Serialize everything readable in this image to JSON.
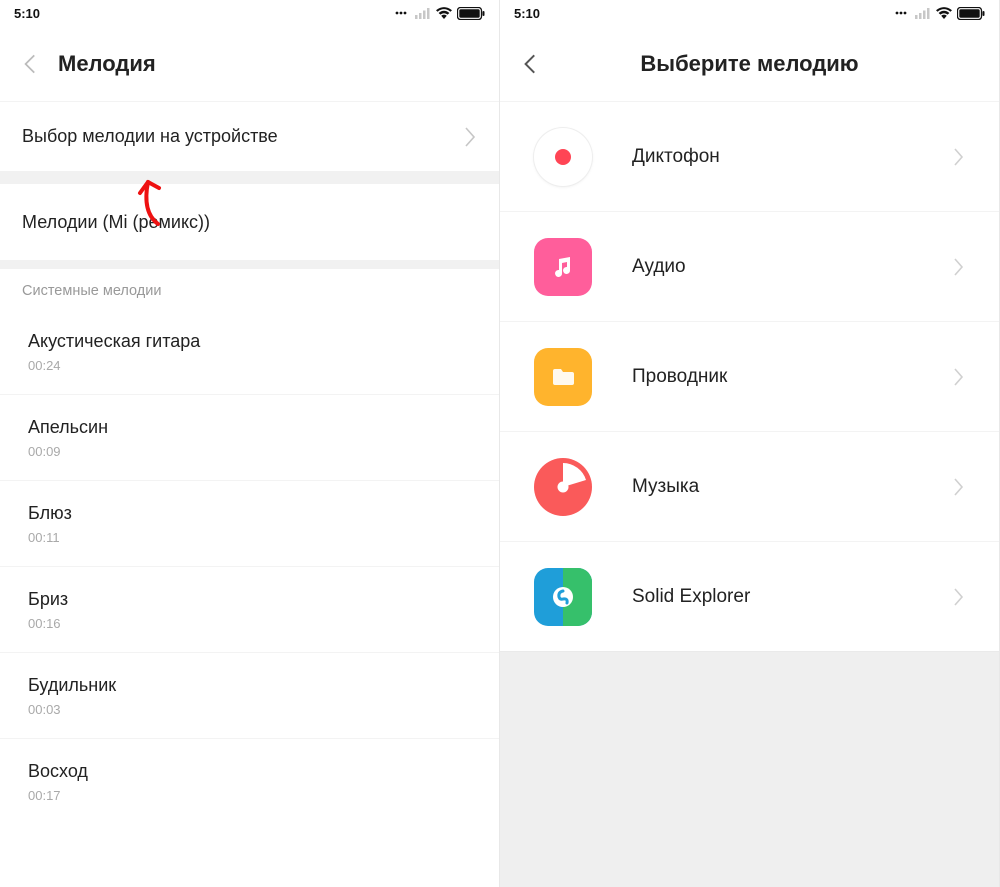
{
  "statusbar": {
    "time": "5:10"
  },
  "left": {
    "title": "Мелодия",
    "select_on_device": "Выбор мелодии на устройстве",
    "mi_remix": "Мелодии (Mi (ремикс))",
    "section_system": "Системные мелодии",
    "ringtones": [
      {
        "name": "Акустическая гитара",
        "duration": "00:24"
      },
      {
        "name": "Апельсин",
        "duration": "00:09"
      },
      {
        "name": "Блюз",
        "duration": "00:11"
      },
      {
        "name": "Бриз",
        "duration": "00:16"
      },
      {
        "name": "Будильник",
        "duration": "00:03"
      },
      {
        "name": "Восход",
        "duration": "00:17"
      }
    ]
  },
  "right": {
    "title": "Выберите мелодию",
    "sources": [
      {
        "id": "recorder",
        "label": "Диктофон"
      },
      {
        "id": "audio",
        "label": "Аудио"
      },
      {
        "id": "explorer",
        "label": "Проводник"
      },
      {
        "id": "music",
        "label": "Музыка"
      },
      {
        "id": "solid",
        "label": "Solid Explorer"
      }
    ]
  },
  "colors": {
    "accent_red": "#ff4555",
    "pink": "#ff5e9b",
    "orange": "#ffb42d",
    "music_red": "#fa5a5a",
    "solid_blue": "#1f9ed9",
    "solid_green": "#36c06b"
  }
}
